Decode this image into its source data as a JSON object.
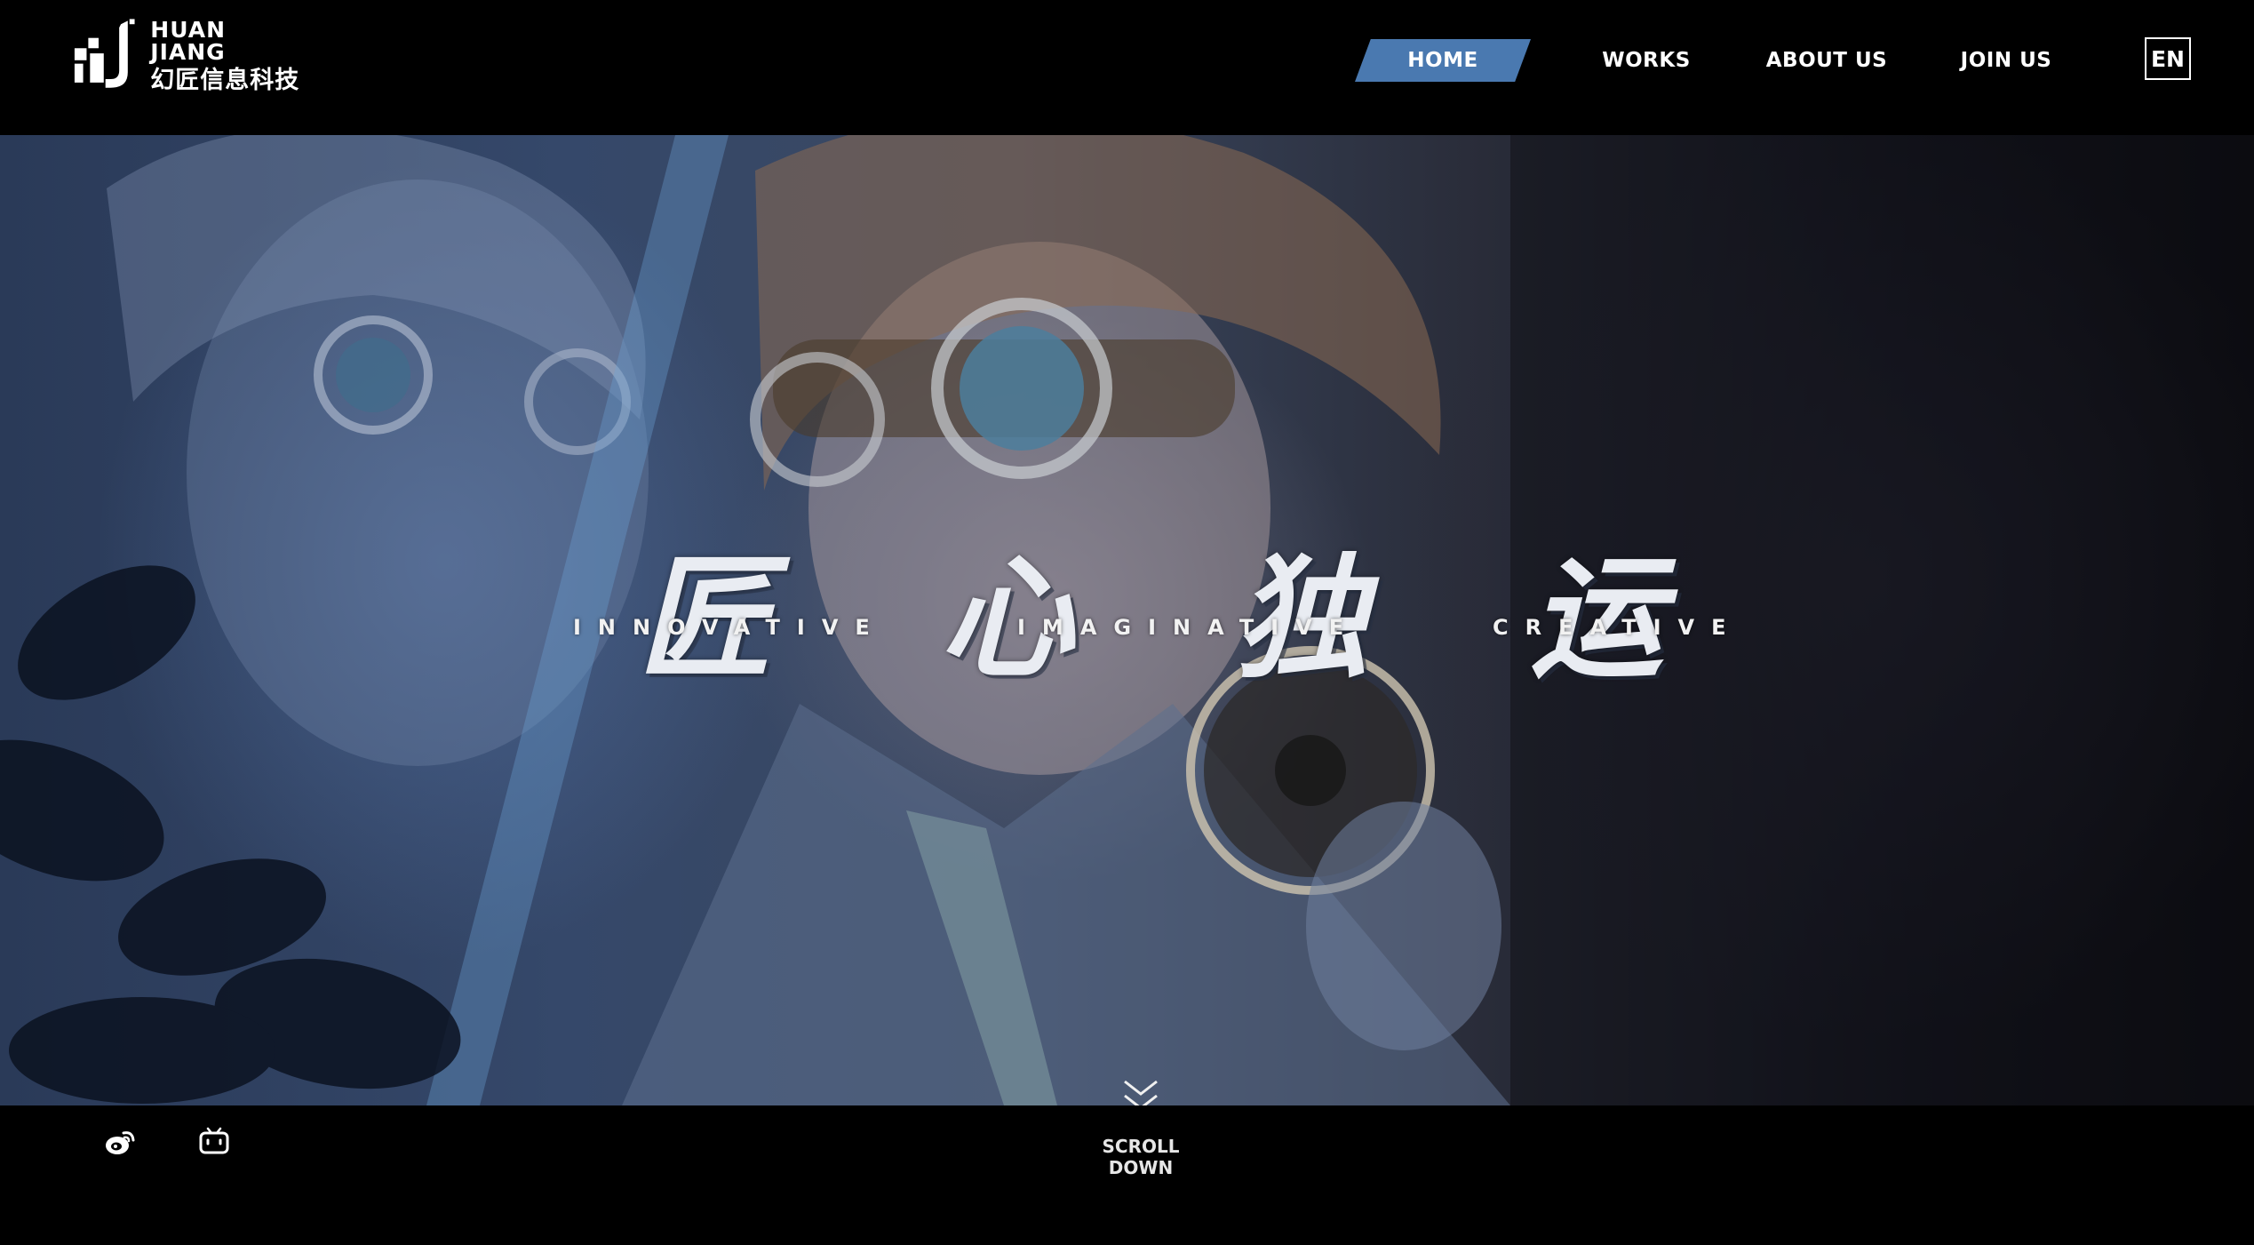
{
  "brand": {
    "name_en": "HUAN JIANG",
    "name_cn": "幻匠信息科技",
    "logo_icon": "hj-logo-icon"
  },
  "nav": {
    "items": [
      {
        "label": "HOME",
        "active": true
      },
      {
        "label": "WORKS",
        "active": false
      },
      {
        "label": "ABOUT US",
        "active": false
      },
      {
        "label": "JOIN US",
        "active": false
      }
    ],
    "active_color": "#4a79b0"
  },
  "language": {
    "label": "EN"
  },
  "hero": {
    "slogan_cn": [
      "匠",
      "心",
      "独",
      "运"
    ],
    "slogan_en": [
      "INNOVATIVE",
      "IMAGINATIVE",
      "CREATIVE"
    ],
    "scroll_icon": "double-chevron-down-icon"
  },
  "footer": {
    "social_icons": [
      "weibo-icon",
      "bilibili-icon"
    ],
    "scroll_label": "SCROLL DOWN"
  }
}
